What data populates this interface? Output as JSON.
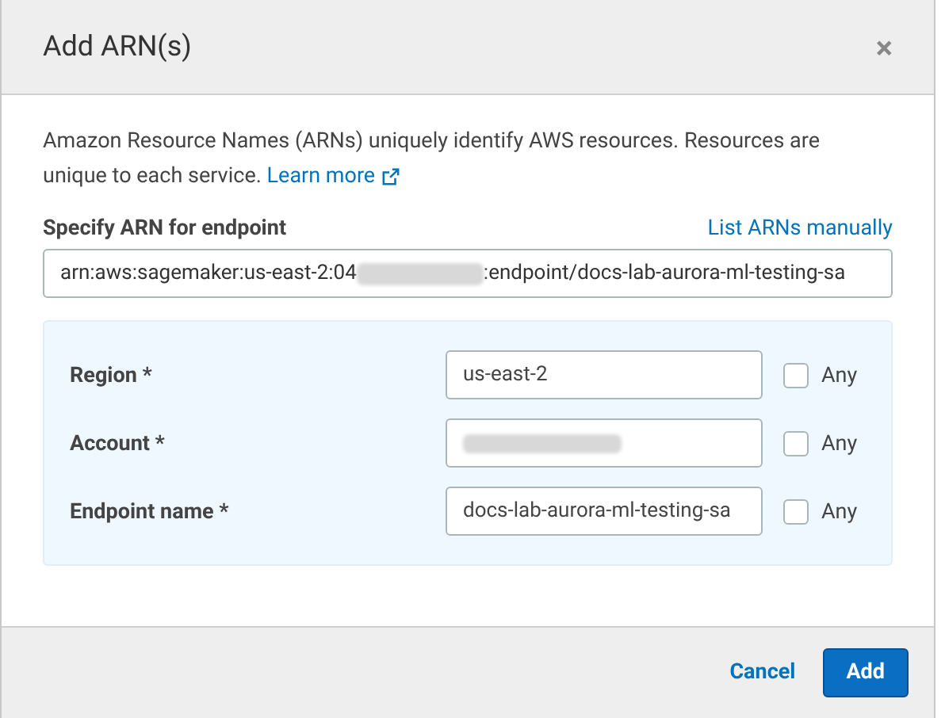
{
  "dialog": {
    "title": "Add ARN(s)",
    "close": "×"
  },
  "description": {
    "text": "Amazon Resource Names (ARNs) uniquely identify AWS resources. Resources are unique to each service.",
    "link": "Learn more"
  },
  "arn": {
    "label": "Specify ARN for endpoint",
    "link": "List ARNs manually",
    "value_start": "arn:aws:sagemaker:us-east-2:04",
    "value_end": ":endpoint/docs-lab-aurora-ml-testing-sa"
  },
  "fields": [
    {
      "label": "Region *",
      "value": "us-east-2",
      "redacted": false,
      "any_label": "Any",
      "checked": false
    },
    {
      "label": "Account *",
      "redacted": true,
      "any_label": "Any",
      "checked": false
    },
    {
      "label": "Endpoint name *",
      "value": "docs-lab-aurora-ml-testing-sa",
      "redacted": false,
      "any_label": "Any",
      "checked": false
    }
  ],
  "buttons": {
    "cancel": "Cancel",
    "add": "Add"
  }
}
